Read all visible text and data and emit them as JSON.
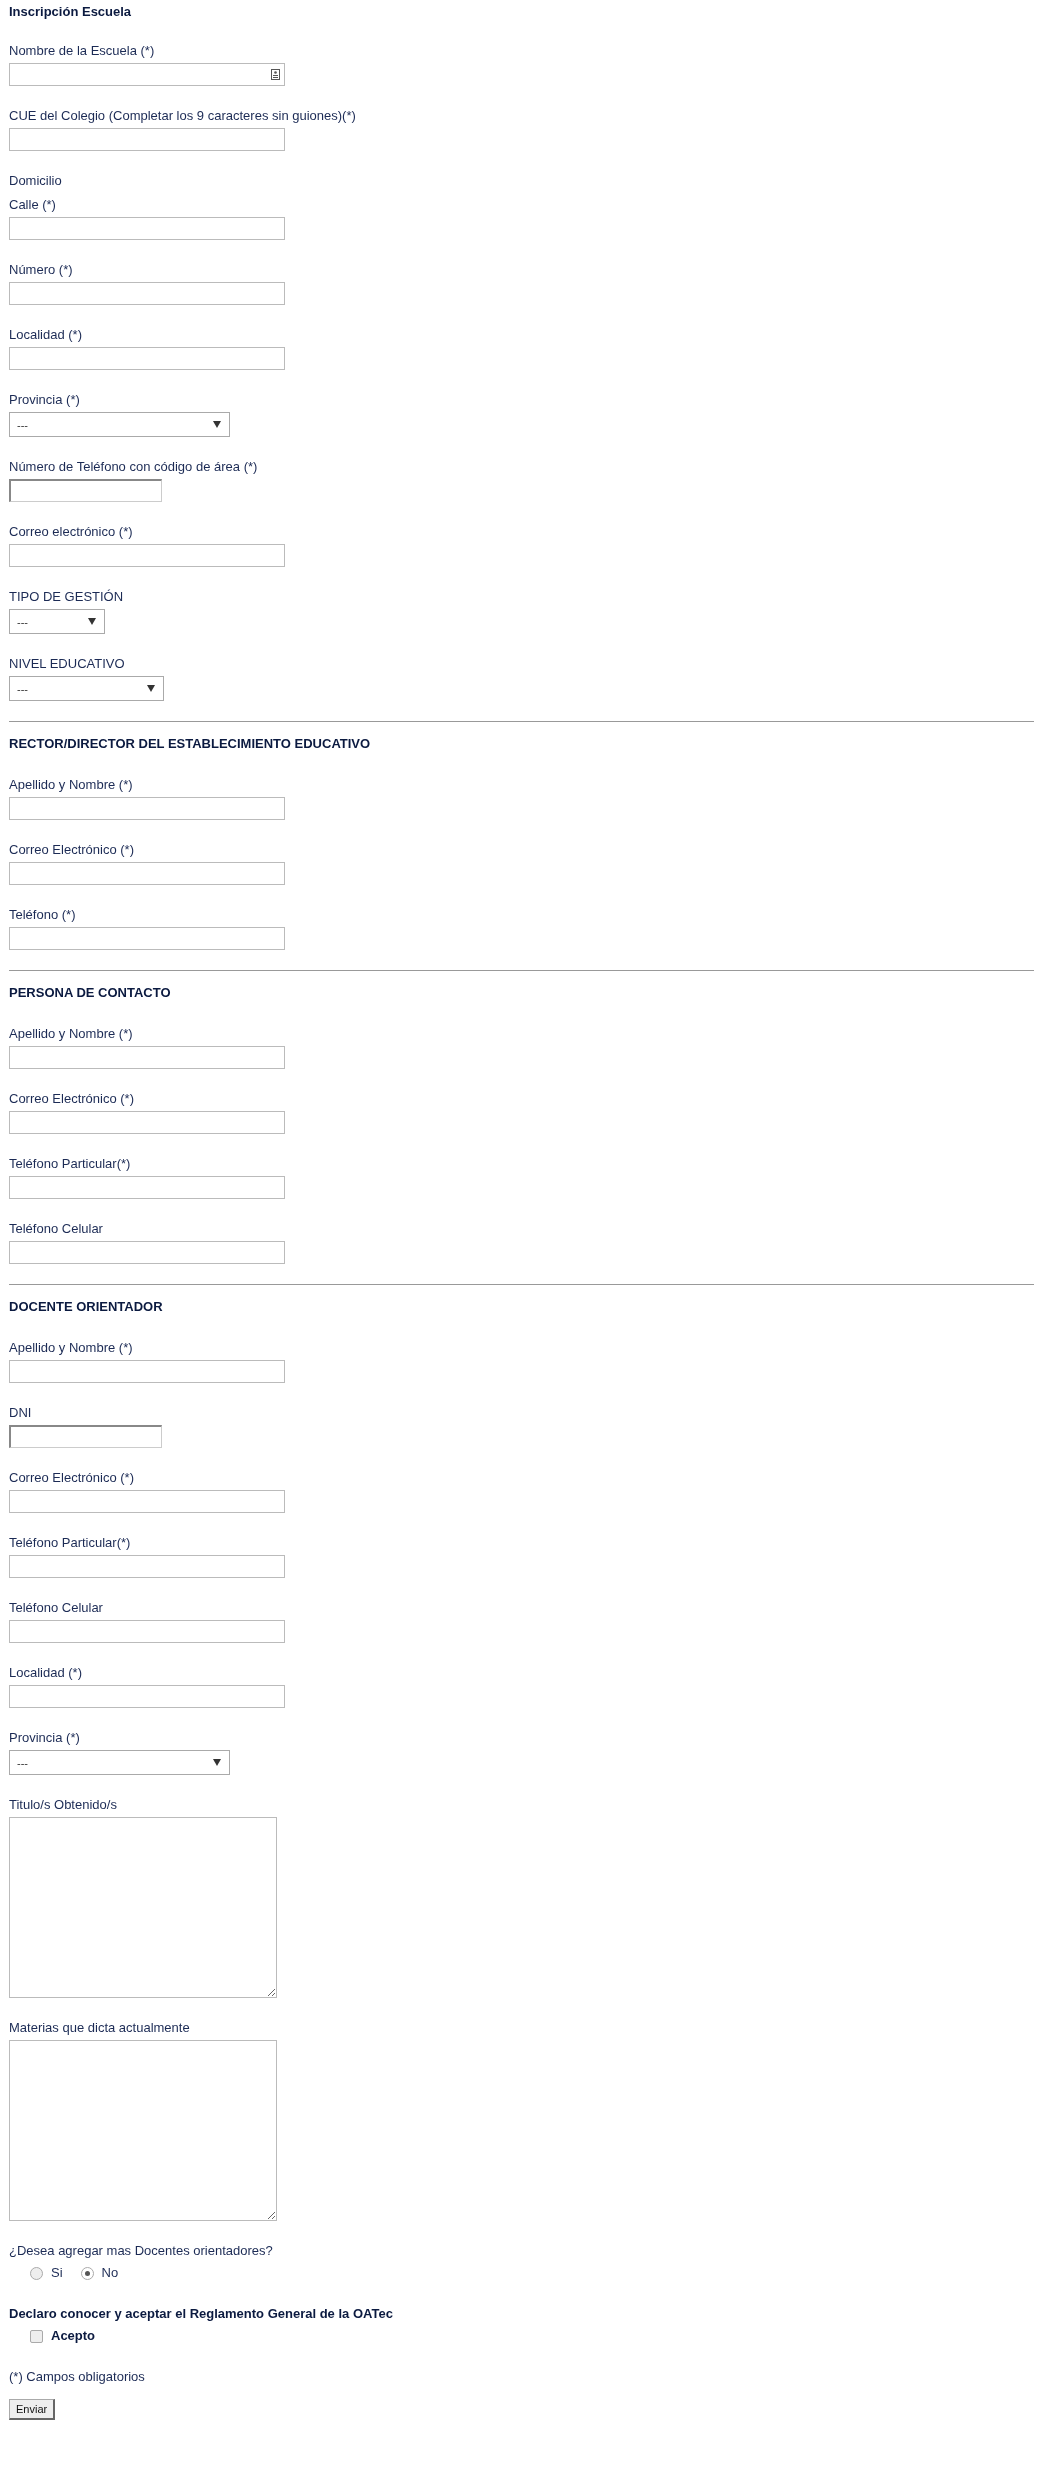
{
  "sections": [
    {
      "title": "Inscripción Escuela",
      "fields": [
        {
          "kind": "text-icon",
          "label": "Nombre de la Escuela (*)"
        },
        {
          "kind": "text",
          "label": "CUE del Colegio (Completar los 9 caracteres sin guiones)(*)"
        },
        {
          "kind": "caption",
          "label": "Domicilio"
        },
        {
          "kind": "text",
          "label": "Calle (*)"
        },
        {
          "kind": "text",
          "label": "Número (*)"
        },
        {
          "kind": "text",
          "label": "Localidad (*)"
        },
        {
          "kind": "select-large",
          "label": "Provincia (*)",
          "value": "---"
        },
        {
          "kind": "short",
          "label": "Número de Teléfono con código de área (*)"
        },
        {
          "kind": "text",
          "label": "Correo electrónico (*)"
        },
        {
          "kind": "select-small",
          "label": "TIPO DE GESTIÓN",
          "value": "---"
        },
        {
          "kind": "select-medium",
          "label": "NIVEL EDUCATIVO",
          "value": "---"
        }
      ]
    },
    {
      "title": "RECTOR/DIRECTOR DEL ESTABLECIMIENTO EDUCATIVO",
      "fields": [
        {
          "kind": "text",
          "label": "Apellido y Nombre (*)"
        },
        {
          "kind": "text",
          "label": "Correo Electrónico (*)"
        },
        {
          "kind": "text",
          "label": "Teléfono (*)"
        }
      ]
    },
    {
      "title": "PERSONA DE CONTACTO",
      "fields": [
        {
          "kind": "text",
          "label": "Apellido y Nombre (*)"
        },
        {
          "kind": "text",
          "label": "Correo Electrónico (*)"
        },
        {
          "kind": "text",
          "label": "Teléfono Particular(*)"
        },
        {
          "kind": "text",
          "label": "Teléfono Celular"
        }
      ]
    },
    {
      "title": "DOCENTE ORIENTADOR",
      "fields": [
        {
          "kind": "text",
          "label": "Apellido y Nombre (*)"
        },
        {
          "kind": "short",
          "label": "DNI"
        },
        {
          "kind": "text",
          "label": "Correo Electrónico (*)"
        },
        {
          "kind": "text",
          "label": "Teléfono Particular(*)"
        },
        {
          "kind": "text",
          "label": "Teléfono Celular"
        },
        {
          "kind": "text",
          "label": "Localidad (*)"
        },
        {
          "kind": "select-large",
          "label": "Provincia (*)",
          "value": "---"
        },
        {
          "kind": "textarea",
          "label": "Titulo/s Obtenido/s"
        },
        {
          "kind": "textarea",
          "label": "Materias que dicta actualmente"
        }
      ]
    }
  ],
  "question": {
    "label": "¿Desea agregar mas Docentes orientadores?",
    "options": [
      {
        "label": "Si",
        "selected": false
      },
      {
        "label": "No",
        "selected": true
      }
    ]
  },
  "declaration": {
    "title": "Declaro conocer y aceptar el Reglamento General de la OATec",
    "checkbox": {
      "label": "Acepto",
      "checked": false
    }
  },
  "note": "(*) Campos obligatorios",
  "submit": "Enviar"
}
